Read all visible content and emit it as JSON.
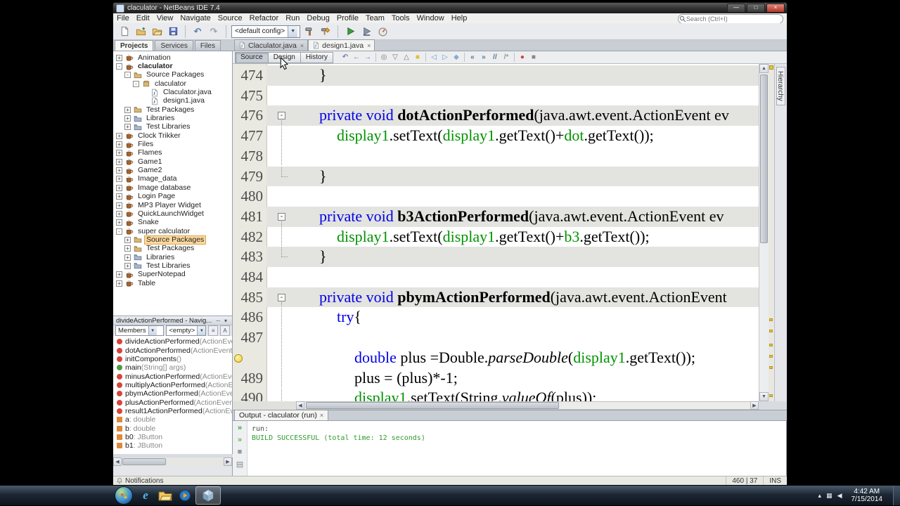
{
  "window_title": "claculator - NetBeans IDE 7.4",
  "window_controls": {
    "minimize": "—",
    "maximize": "□",
    "close": "×"
  },
  "menu": {
    "items": [
      "File",
      "Edit",
      "View",
      "Navigate",
      "Source",
      "Refactor",
      "Run",
      "Debug",
      "Profile",
      "Team",
      "Tools",
      "Window",
      "Help"
    ]
  },
  "search": {
    "placeholder": "Search (Ctrl+I)"
  },
  "toolbar": {
    "config_combo": "<default config>",
    "items": [
      {
        "name": "new-file-button",
        "icon": "page"
      },
      {
        "name": "new-project-button",
        "icon": "folder-new"
      },
      {
        "name": "open-project-button",
        "icon": "folder-open"
      },
      {
        "name": "save-all-button",
        "icon": "floppy"
      },
      {
        "sep": true
      },
      {
        "name": "undo-button",
        "glyph": "↶",
        "color": "#5a7ca8"
      },
      {
        "name": "redo-button",
        "glyph": "↷",
        "color": "#9aa4b0"
      },
      {
        "sep": true
      },
      {
        "name": "configuration-combo",
        "combo": true
      },
      {
        "name": "build-project-button",
        "icon": "hammer"
      },
      {
        "name": "clean-build-project-button",
        "icon": "broom"
      },
      {
        "sep": true
      },
      {
        "name": "run-project-button",
        "icon": "play"
      },
      {
        "name": "debug-project-button",
        "icon": "debug"
      },
      {
        "name": "profile-project-button",
        "icon": "profile"
      }
    ]
  },
  "left_tabs": [
    {
      "label": "Projects",
      "active": true
    },
    {
      "label": "Services",
      "active": false
    },
    {
      "label": "Files",
      "active": false
    }
  ],
  "project_tree": [
    {
      "label": "Animation",
      "depth": 0,
      "expander": "+",
      "icon": "project"
    },
    {
      "label": "claculator",
      "depth": 0,
      "expander": "-",
      "icon": "project",
      "bold": true
    },
    {
      "label": "Source Packages",
      "depth": 1,
      "expander": "-",
      "icon": "srcfolder"
    },
    {
      "label": "claculator",
      "depth": 2,
      "expander": "-",
      "icon": "package"
    },
    {
      "label": "Claculator.java",
      "depth": 3,
      "expander": "",
      "icon": "javafile"
    },
    {
      "label": "design1.java",
      "depth": 3,
      "expander": "",
      "icon": "javafile"
    },
    {
      "label": "Test Packages",
      "depth": 1,
      "expander": "+",
      "icon": "srcfolder"
    },
    {
      "label": "Libraries",
      "depth": 1,
      "expander": "+",
      "icon": "libfolder"
    },
    {
      "label": "Test Libraries",
      "depth": 1,
      "expander": "+",
      "icon": "libfolder"
    },
    {
      "label": "Clock Trikker",
      "depth": 0,
      "expander": "+",
      "icon": "project"
    },
    {
      "label": "Files",
      "depth": 0,
      "expander": "+",
      "icon": "project"
    },
    {
      "label": "Flames",
      "depth": 0,
      "expander": "+",
      "icon": "project"
    },
    {
      "label": "Game1",
      "depth": 0,
      "expander": "+",
      "icon": "project"
    },
    {
      "label": "Game2",
      "depth": 0,
      "expander": "+",
      "icon": "project"
    },
    {
      "label": "Image_data",
      "depth": 0,
      "expander": "+",
      "icon": "project"
    },
    {
      "label": "Image database",
      "depth": 0,
      "expander": "+",
      "icon": "project"
    },
    {
      "label": "Login Page",
      "depth": 0,
      "expander": "+",
      "icon": "project"
    },
    {
      "label": "MP3 Player Widget",
      "depth": 0,
      "expander": "+",
      "icon": "project"
    },
    {
      "label": "QuickLaunchWidget",
      "depth": 0,
      "expander": "+",
      "icon": "project"
    },
    {
      "label": "Snake",
      "depth": 0,
      "expander": "+",
      "icon": "project"
    },
    {
      "label": "super calculator",
      "depth": 0,
      "expander": "-",
      "icon": "project"
    },
    {
      "label": "Source Packages",
      "depth": 1,
      "expander": "+",
      "icon": "srcfolder",
      "selected": true
    },
    {
      "label": "Test Packages",
      "depth": 1,
      "expander": "+",
      "icon": "srcfolder"
    },
    {
      "label": "Libraries",
      "depth": 1,
      "expander": "+",
      "icon": "libfolder"
    },
    {
      "label": "Test Libraries",
      "depth": 1,
      "expander": "+",
      "icon": "libfolder"
    },
    {
      "label": "SuperNotepad",
      "depth": 0,
      "expander": "+",
      "icon": "project"
    },
    {
      "label": "Table",
      "depth": 0,
      "expander": "+",
      "icon": "project"
    }
  ],
  "navigator": {
    "title": "divideActionPerformed - Navig...",
    "filters": [
      "Members",
      "<empty>"
    ],
    "items": [
      {
        "name": "divideActionPerformed",
        "params": "(ActionEvent e",
        "icon": "method-private"
      },
      {
        "name": "dotActionPerformed",
        "params": "(ActionEvent evt",
        "icon": "method-private"
      },
      {
        "name": "initComponents",
        "params": "()",
        "icon": "method-private"
      },
      {
        "name": "main",
        "params": "(String[] args)",
        "icon": "method-public"
      },
      {
        "name": "minusActionPerformed",
        "params": "(ActionEvent e",
        "icon": "method-private"
      },
      {
        "name": "multiplyActionPerformed",
        "params": "(ActionEvent",
        "icon": "method-private"
      },
      {
        "name": "pbymActionPerformed",
        "params": "(ActionEvent e",
        "icon": "method-private"
      },
      {
        "name": "plusActionPerformed",
        "params": "(ActionEvent e",
        "icon": "method-private"
      },
      {
        "name": "result1ActionPerformed",
        "params": "(ActionEvent",
        "icon": "method-private"
      },
      {
        "name": "a",
        "params": " : double",
        "icon": "field-private"
      },
      {
        "name": "b",
        "params": " : double",
        "icon": "field-private"
      },
      {
        "name": "b0",
        "params": " : JButton",
        "icon": "field-private"
      },
      {
        "name": "b1",
        "params": " : JButton",
        "icon": "field-private"
      }
    ]
  },
  "editor": {
    "tabs": [
      {
        "label": "Claculator.java",
        "active": false
      },
      {
        "label": "design1.java",
        "active": true
      }
    ],
    "views": [
      {
        "label": "Source",
        "active": true
      },
      {
        "label": "Design",
        "active": false
      },
      {
        "label": "History",
        "active": false
      }
    ],
    "toolbar_icons": [
      {
        "name": "last-edit-icon",
        "glyph": "↶",
        "color": "#8a6fb8"
      },
      {
        "name": "back-icon",
        "glyph": "←",
        "color": "#5577aa"
      },
      {
        "name": "forward-icon",
        "glyph": "→",
        "color": "#5577aa"
      },
      {
        "sep": true
      },
      {
        "name": "find-selection-icon",
        "glyph": "◎",
        "color": "#777777"
      },
      {
        "name": "find-next-icon",
        "glyph": "▽",
        "color": "#777777"
      },
      {
        "name": "find-previous-icon",
        "glyph": "△",
        "color": "#777777"
      },
      {
        "name": "toggle-highlight-icon",
        "glyph": "■",
        "color": "#d9c43a"
      },
      {
        "sep": true
      },
      {
        "name": "previous-bookmark-icon",
        "glyph": "◁",
        "color": "#6699cc"
      },
      {
        "name": "next-bookmark-icon",
        "glyph": "▷",
        "color": "#6699cc"
      },
      {
        "name": "toggle-bookmark-icon",
        "glyph": "◆",
        "color": "#88aacc"
      },
      {
        "sep": true
      },
      {
        "name": "shift-left-icon",
        "glyph": "«",
        "color": "#557799"
      },
      {
        "name": "shift-right-icon",
        "glyph": "»",
        "color": "#557799"
      },
      {
        "name": "comment-icon",
        "glyph": "//",
        "color": "#557799"
      },
      {
        "name": "uncomment-icon",
        "glyph": "/*",
        "color": "#999999"
      },
      {
        "sep": true
      },
      {
        "name": "macro-record-icon",
        "glyph": "●",
        "color": "#cc4444"
      },
      {
        "name": "macro-stop-icon",
        "glyph": "■",
        "color": "#888888"
      }
    ],
    "hierarchy_tab": "Hierarchy",
    "error_stripe_marks_y": [
      362,
      378,
      398,
      414,
      430,
      470
    ],
    "code": {
      "colors": {
        "keyword": "#0000e6",
        "field": "#009300"
      },
      "lines": [
        {
          "n": "474",
          "band": true,
          "fold": "",
          "indent": 1,
          "tokens": [
            {
              "s": "}",
              "c": ""
            }
          ]
        },
        {
          "n": "475",
          "fold": "",
          "indent": 0,
          "tokens": []
        },
        {
          "n": "476",
          "band": true,
          "fold": "start",
          "indent": 1,
          "tokens": [
            {
              "s": "private void ",
              "c": "kw"
            },
            {
              "s": "dotActionPerformed",
              "c": "bold"
            },
            {
              "s": "(java.awt.event.ActionEvent ev",
              "c": ""
            }
          ]
        },
        {
          "n": "477",
          "fold": "mid",
          "indent": 2,
          "tokens": [
            {
              "s": "display1",
              "c": "fld"
            },
            {
              "s": ".setText(",
              "c": ""
            },
            {
              "s": "display1",
              "c": "fld"
            },
            {
              "s": ".getText()+",
              "c": ""
            },
            {
              "s": "dot",
              "c": "fld"
            },
            {
              "s": ".getText());",
              "c": ""
            }
          ]
        },
        {
          "n": "478",
          "fold": "mid",
          "indent": 0,
          "tokens": []
        },
        {
          "n": "479",
          "band": true,
          "fold": "end",
          "indent": 1,
          "tokens": [
            {
              "s": "}",
              "c": ""
            }
          ]
        },
        {
          "n": "480",
          "fold": "",
          "indent": 0,
          "tokens": []
        },
        {
          "n": "481",
          "band": true,
          "fold": "start",
          "indent": 1,
          "tokens": [
            {
              "s": "private void ",
              "c": "kw"
            },
            {
              "s": "b3ActionPerformed",
              "c": "bold"
            },
            {
              "s": "(java.awt.event.ActionEvent ev",
              "c": ""
            }
          ]
        },
        {
          "n": "482",
          "fold": "mid",
          "indent": 2,
          "tokens": [
            {
              "s": "display1",
              "c": "fld"
            },
            {
              "s": ".setText(",
              "c": ""
            },
            {
              "s": "display1",
              "c": "fld"
            },
            {
              "s": ".getText()+",
              "c": ""
            },
            {
              "s": "b3",
              "c": "fld"
            },
            {
              "s": ".getText());",
              "c": ""
            }
          ]
        },
        {
          "n": "483",
          "band": true,
          "fold": "end",
          "indent": 1,
          "tokens": [
            {
              "s": "}",
              "c": ""
            }
          ]
        },
        {
          "n": "484",
          "fold": "",
          "indent": 0,
          "tokens": []
        },
        {
          "n": "485",
          "band": true,
          "fold": "start",
          "indent": 1,
          "tokens": [
            {
              "s": "private void ",
              "c": "kw"
            },
            {
              "s": "pbymActionPerformed",
              "c": "bold"
            },
            {
              "s": "(java.awt.event.ActionEvent",
              "c": ""
            }
          ]
        },
        {
          "n": "486",
          "fold": "mid",
          "indent": 2,
          "tokens": [
            {
              "s": "try",
              "c": "kw"
            },
            {
              "s": "{",
              "c": ""
            }
          ]
        },
        {
          "n": "487",
          "fold": "mid",
          "indent": 0,
          "tokens": []
        },
        {
          "n": "",
          "gicon": "warning-bulb",
          "fold": "mid",
          "indent": 3,
          "tokens": [
            {
              "s": "double",
              "c": "kw"
            },
            {
              "s": " plus =Double.",
              "c": ""
            },
            {
              "s": "parseDouble",
              "c": "it"
            },
            {
              "s": "(",
              "c": ""
            },
            {
              "s": "display1",
              "c": "fld"
            },
            {
              "s": ".getText());",
              "c": ""
            }
          ]
        },
        {
          "n": "489",
          "fold": "mid",
          "indent": 3,
          "tokens": [
            {
              "s": "plus = (plus)*-1;",
              "c": ""
            }
          ]
        },
        {
          "n": "490",
          "fold": "mid",
          "indent": 3,
          "tokens": [
            {
              "s": "display1",
              "c": "fld"
            },
            {
              "s": ".setText(String.",
              "c": ""
            },
            {
              "s": "valueOf",
              "c": "it"
            },
            {
              "s": "(plus));",
              "c": ""
            }
          ]
        }
      ]
    }
  },
  "output": {
    "tab": "Output - claculator (run)",
    "strip_icons": [
      {
        "name": "rerun-button",
        "glyph": "»",
        "color": "#3f9b3f"
      },
      {
        "name": "rerun-debug-button",
        "glyph": "»",
        "color": "#6fae5f"
      },
      {
        "name": "stop-build-button",
        "glyph": "■",
        "color": "#9a9a9a"
      },
      {
        "name": "clear-output-button",
        "glyph": "▤",
        "color": "#8a8a8a"
      }
    ],
    "lines": [
      {
        "text": "run:",
        "color": "#4a4a4a"
      },
      {
        "text": "BUILD SUCCESSFUL (total time: 12 seconds)",
        "color": "#2f9b2f"
      }
    ]
  },
  "statusbar": {
    "notifications": "Notifications",
    "caret": "460 | 37",
    "mode": "INS"
  },
  "taskbar": {
    "clock_time": "4:42 AM",
    "clock_date": "7/15/2014",
    "apps": [
      {
        "name": "internet-explorer-button",
        "icon": "ie"
      },
      {
        "name": "explorer-button",
        "icon": "folder-win"
      },
      {
        "name": "media-player-button",
        "icon": "wmp"
      },
      {
        "name": "netbeans-taskbar-button",
        "icon": "netbeans",
        "pressed": true
      }
    ],
    "tray_icons": [
      {
        "name": "show-hidden-icons-button",
        "glyph": "▴"
      },
      {
        "name": "network-icon",
        "glyph": "▦"
      },
      {
        "name": "volume-icon",
        "glyph": "◀"
      }
    ]
  }
}
